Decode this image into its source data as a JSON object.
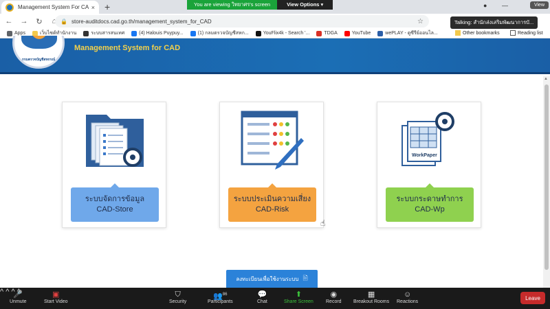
{
  "browser": {
    "tab_title": "Management System For CAD",
    "tab_close": "×",
    "new_tab": "+",
    "url": "store-auditdocs.cad.go.th/management_system_for_CAD",
    "zoom_viewing": "You are viewing วิทยาศร's screen",
    "view_options": "View Options ▾",
    "view_button": "View",
    "talking": "Talking: สำนักส่งเสริมพัฒนาการบั..."
  },
  "bookmarks": {
    "items": [
      {
        "label": "Apps",
        "color": "#5f6368"
      },
      {
        "label": "เว็บไซต์ทำนักงาน",
        "color": "#f2c94c"
      },
      {
        "label": "ระบบสารสนเทศ",
        "color": "#333333"
      },
      {
        "label": "(4) Halouis Puypuy...",
        "color": "#1877f2"
      },
      {
        "label": "(1) กลมตรวจบัญชีสหก...",
        "color": "#1877f2"
      },
      {
        "label": "YouFlix4k - Search '...",
        "color": "#111111"
      },
      {
        "label": "TDGA",
        "color": "#d93025"
      },
      {
        "label": "YouTube",
        "color": "#ff0000"
      },
      {
        "label": "wePLAY - ดูซีรีย์ออนไล...",
        "color": "#2b5ea7"
      }
    ],
    "other": "Other bookmarks",
    "reading": "Reading list"
  },
  "site": {
    "title": "Management System for CAD",
    "logo_text": "กรมตรวจบัญชีสหกรณ์"
  },
  "cards": [
    {
      "line1": "ระบบจัดการข้อมูล",
      "line2": "CAD-Store",
      "color": "#6fa8ea"
    },
    {
      "line1": "ระบบประเมินความเสี่ยง",
      "line2": "CAD-Risk",
      "color": "#f4a340"
    },
    {
      "line1": "ระบบกระดาษทำการ",
      "line2": "CAD-Wp",
      "color": "#8fd14f"
    }
  ],
  "workpaper_label": "WorkPaper",
  "register_label": "ลงทะเบียนเพื่อใช้งานระบบ",
  "zoom": {
    "unmute": "Unmute",
    "start_video": "Start Video",
    "security": "Security",
    "participants": "Participants",
    "participants_count": "86",
    "chat": "Chat",
    "share_screen": "Share Screen",
    "record": "Record",
    "breakout": "Breakout Rooms",
    "reactions": "Reactions",
    "leave": "Leave"
  }
}
